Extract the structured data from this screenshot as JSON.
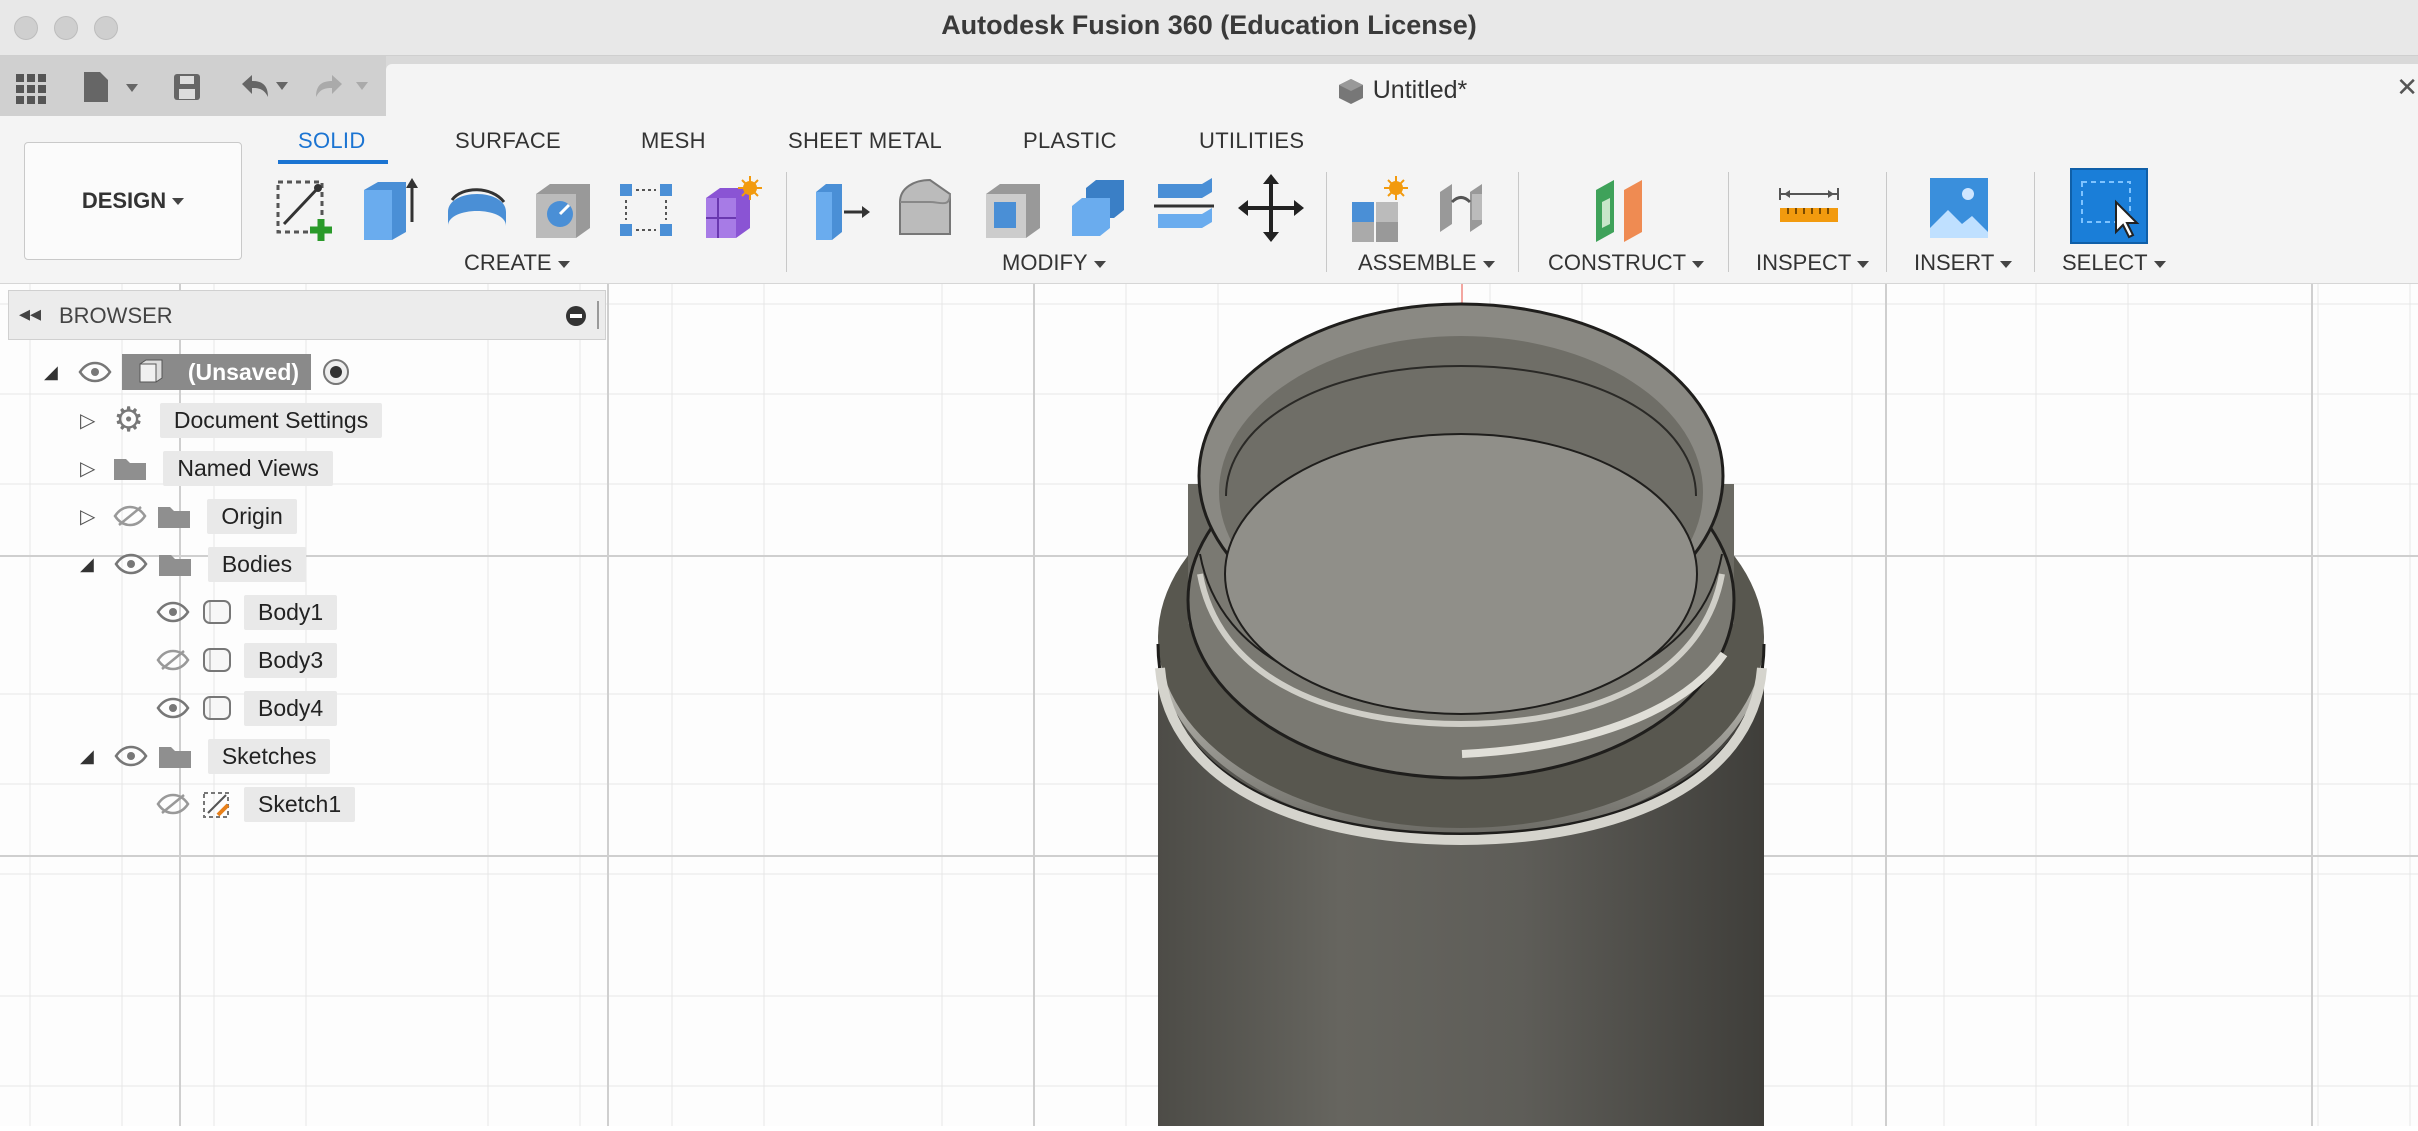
{
  "window": {
    "title": "Autodesk Fusion 360 (Education License)"
  },
  "document": {
    "title": "Untitled*"
  },
  "workspace": {
    "label": "DESIGN"
  },
  "ribbon_tabs": [
    "SOLID",
    "SURFACE",
    "MESH",
    "SHEET METAL",
    "PLASTIC",
    "UTILITIES"
  ],
  "groups": {
    "create": "CREATE",
    "modify": "MODIFY",
    "assemble": "ASSEMBLE",
    "construct": "CONSTRUCT",
    "inspect": "INSPECT",
    "insert": "INSERT",
    "select": "SELECT"
  },
  "browser": {
    "title": "BROWSER",
    "root": "(Unsaved)",
    "items": [
      "Document Settings",
      "Named Views",
      "Origin",
      "Bodies",
      "Body1",
      "Body3",
      "Body4",
      "Sketches",
      "Sketch1"
    ]
  },
  "colors": {
    "accent": "#1b74d2",
    "select_button": "#1a7ed8",
    "body_gray": "#5e5d58"
  }
}
